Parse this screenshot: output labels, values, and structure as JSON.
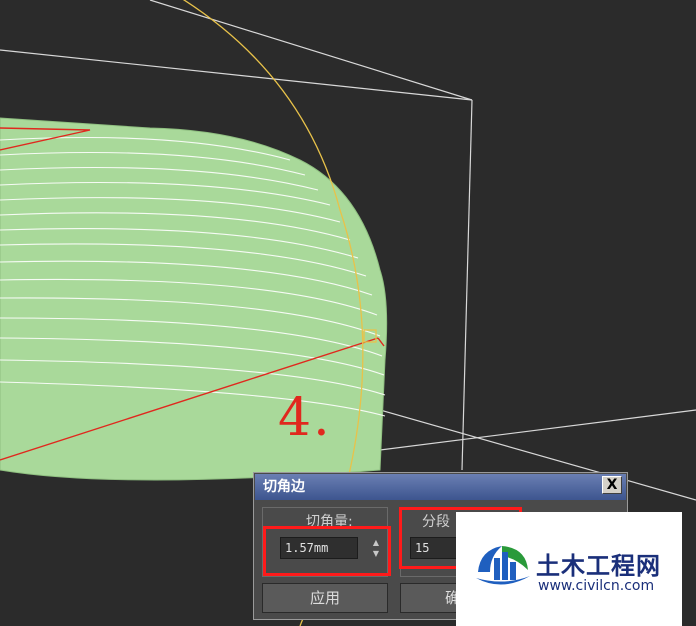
{
  "viewport": {
    "annotation": "4.",
    "colors": {
      "background": "#2b2b2b",
      "object_fill": "#a9d99a",
      "wireframe": "#ffffff",
      "gizmo": "#e8c24a",
      "edge_selected": "#e0281e"
    }
  },
  "dialog": {
    "title": "切角边",
    "close_label": "X",
    "amount_label": "切角量:",
    "amount_value": "1.57mm",
    "segments_label": "分段",
    "segments_value": "15",
    "apply_label": "应用",
    "ok_label": "确定",
    "highlight_color": "#ff1a1a"
  },
  "watermark": {
    "title": "土木工程网",
    "url": "www.civilcn.com"
  }
}
